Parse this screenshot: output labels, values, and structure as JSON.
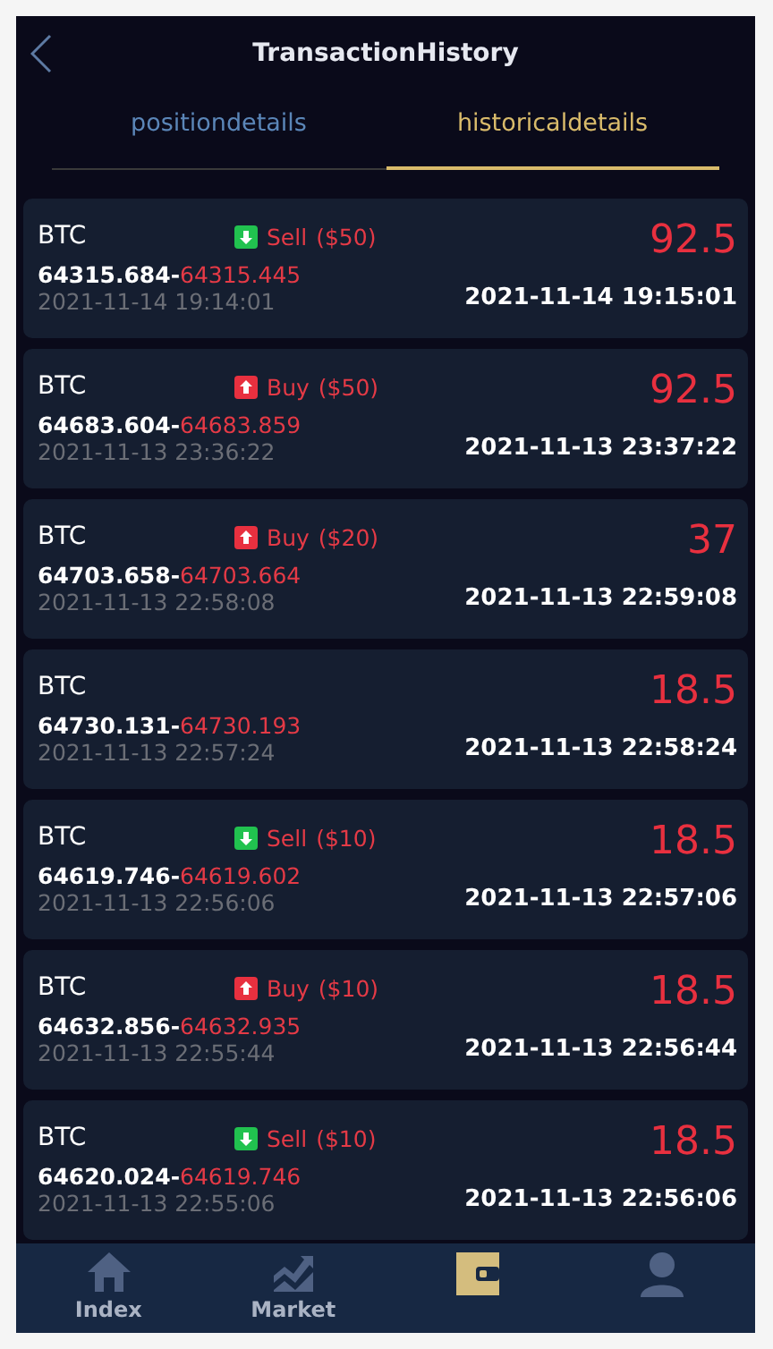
{
  "header": {
    "title": "TransactionHistory"
  },
  "tabs": [
    {
      "label": "positiondetails",
      "selected": false
    },
    {
      "label": "historicaldetails",
      "selected": true
    }
  ],
  "records": [
    {
      "symbol": "BTC",
      "direction": {
        "kind": "sell",
        "label": "Sell",
        "amount": "($50)"
      },
      "open_price": "64315.684-",
      "close_price": "64315.445",
      "open_time": "2021-11-14 19:14:01",
      "profit": "92.5",
      "close_time": "2021-11-14 19:15:01"
    },
    {
      "symbol": "BTC",
      "direction": {
        "kind": "buy",
        "label": "Buy",
        "amount": "($50)"
      },
      "open_price": "64683.604-",
      "close_price": "64683.859",
      "open_time": "2021-11-13 23:36:22",
      "profit": "92.5",
      "close_time": "2021-11-13 23:37:22"
    },
    {
      "symbol": "BTC",
      "direction": {
        "kind": "buy",
        "label": "Buy",
        "amount": "($20)"
      },
      "open_price": "64703.658-",
      "close_price": "64703.664",
      "open_time": "2021-11-13 22:58:08",
      "profit": "37",
      "close_time": "2021-11-13 22:59:08"
    },
    {
      "symbol": "BTC",
      "open_price": "64730.131-",
      "close_price": "64730.193",
      "open_time": "2021-11-13 22:57:24",
      "profit": "18.5",
      "close_time": "2021-11-13 22:58:24"
    },
    {
      "symbol": "BTC",
      "direction": {
        "kind": "sell",
        "label": "Sell",
        "amount": "($10)"
      },
      "open_price": "64619.746-",
      "close_price": "64619.602",
      "open_time": "2021-11-13 22:56:06",
      "profit": "18.5",
      "close_time": "2021-11-13 22:57:06"
    },
    {
      "symbol": "BTC",
      "direction": {
        "kind": "buy",
        "label": "Buy",
        "amount": "($10)"
      },
      "open_price": "64632.856-",
      "close_price": "64632.935",
      "open_time": "2021-11-13 22:55:44",
      "profit": "18.5",
      "close_time": "2021-11-13 22:56:44"
    },
    {
      "symbol": "BTC",
      "direction": {
        "kind": "sell",
        "label": "Sell",
        "amount": "($10)"
      },
      "open_price": "64620.024-",
      "close_price": "64619.746",
      "open_time": "2021-11-13 22:55:06",
      "profit": "18.5",
      "close_time": "2021-11-13 22:56:06"
    }
  ],
  "nav": [
    {
      "kind": "home",
      "label": "Index",
      "selected": false
    },
    {
      "kind": "chart",
      "label": "Market",
      "selected": false
    },
    {
      "kind": "wallet",
      "selected": true
    },
    {
      "kind": "user",
      "selected": false
    }
  ]
}
